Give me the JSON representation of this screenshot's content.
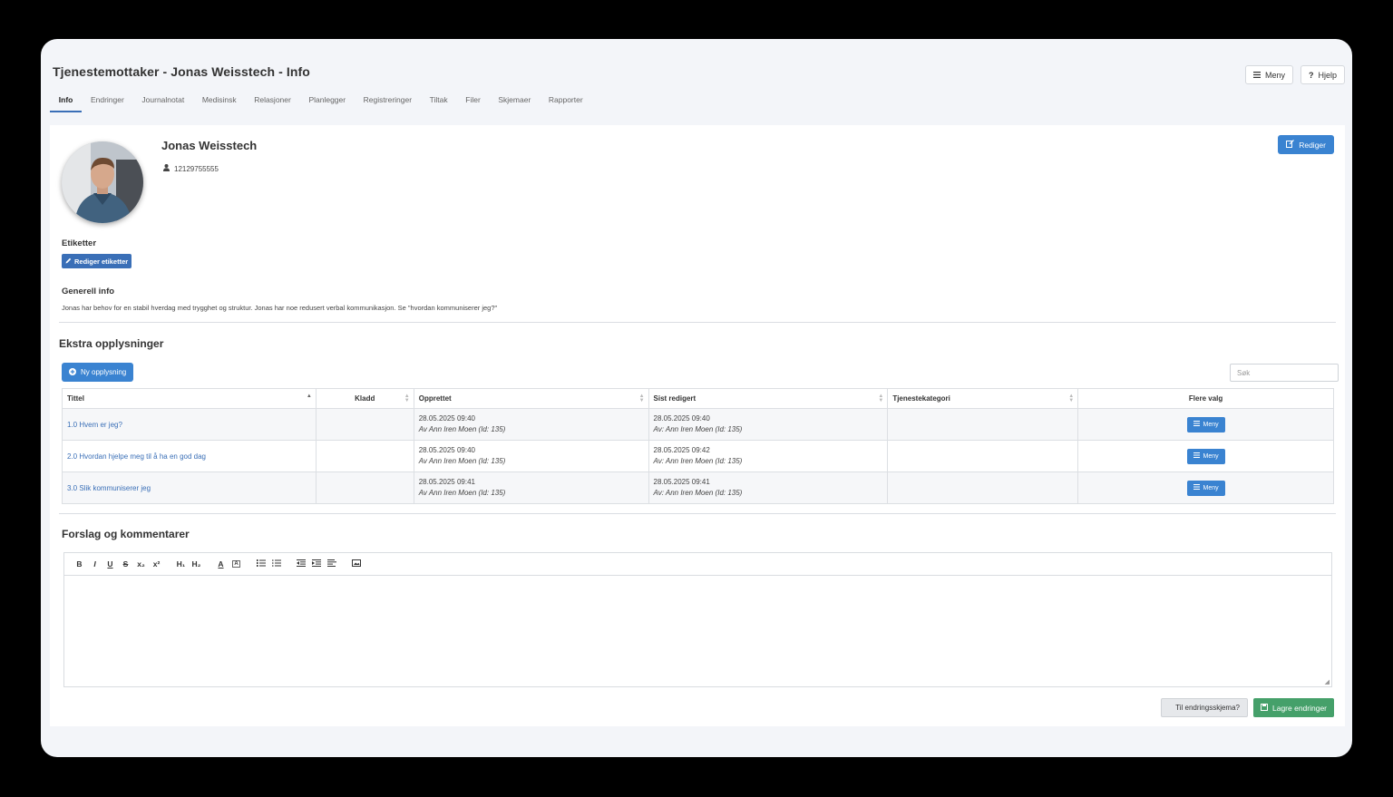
{
  "page": {
    "title": "Tjenestemottaker - Jonas Weisstech - Info",
    "menu_label": "Meny",
    "help_label": "Hjelp"
  },
  "tabs": [
    {
      "label": "Info",
      "active": true
    },
    {
      "label": "Endringer"
    },
    {
      "label": "Journalnotat"
    },
    {
      "label": "Medisinsk"
    },
    {
      "label": "Relasjoner"
    },
    {
      "label": "Planlegger"
    },
    {
      "label": "Registreringer"
    },
    {
      "label": "Tiltak"
    },
    {
      "label": "Filer"
    },
    {
      "label": "Skjemaer"
    },
    {
      "label": "Rapporter"
    }
  ],
  "profile": {
    "name": "Jonas Weisstech",
    "id_number": "12129755555",
    "edit_label": "Rediger"
  },
  "tags": {
    "title": "Etiketter",
    "edit_label": "Rediger etiketter"
  },
  "general": {
    "title": "Generell info",
    "text": "Jonas har behov for en stabil hverdag med trygghet og struktur. Jonas har noe redusert verbal kommunikasjon. Se \"hvordan kommuniserer jeg?\""
  },
  "extra": {
    "title": "Ekstra opplysninger",
    "new_label": "Ny opplysning",
    "search_placeholder": "Søk",
    "columns": [
      "Tittel",
      "Kladd",
      "Opprettet",
      "Sist redigert",
      "Tjenestekategori",
      "Flere valg"
    ],
    "rows": [
      {
        "title": "1.0 Hvem er jeg?",
        "draft": "",
        "created": "28.05.2025 09:40",
        "created_by": "Av Ann Iren Moen (Id: 135)",
        "edited": "28.05.2025 09:40",
        "edited_by": "Av: Ann Iren Moen (Id: 135)",
        "category": "",
        "menu": "Meny"
      },
      {
        "title": "2.0 Hvordan hjelpe meg til å ha en god dag",
        "draft": "",
        "created": "28.05.2025 09:40",
        "created_by": "Av Ann Iren Moen (Id: 135)",
        "edited": "28.05.2025 09:42",
        "edited_by": "Av: Ann Iren Moen (Id: 135)",
        "category": "",
        "menu": "Meny"
      },
      {
        "title": "3.0 Slik kommuniserer jeg",
        "draft": "",
        "created": "28.05.2025 09:41",
        "created_by": "Av Ann Iren Moen (Id: 135)",
        "edited": "28.05.2025 09:41",
        "edited_by": "Av: Ann Iren Moen (Id: 135)",
        "category": "",
        "menu": "Meny"
      }
    ]
  },
  "comments": {
    "title": "Forslag og kommentarer",
    "toolbar": [
      "B",
      "I",
      "U",
      "S",
      "x₂",
      "x²",
      "H₁",
      "H₂",
      "A",
      "A",
      "ol",
      "ul",
      "outdent",
      "indent",
      "align",
      "image"
    ]
  },
  "footer": {
    "change_form_label": "Til endringsskjema?",
    "save_label": "Lagre endringer"
  },
  "colors": {
    "primary": "#3a83d1",
    "tag": "#3a6fb7",
    "save": "#45a06a"
  }
}
